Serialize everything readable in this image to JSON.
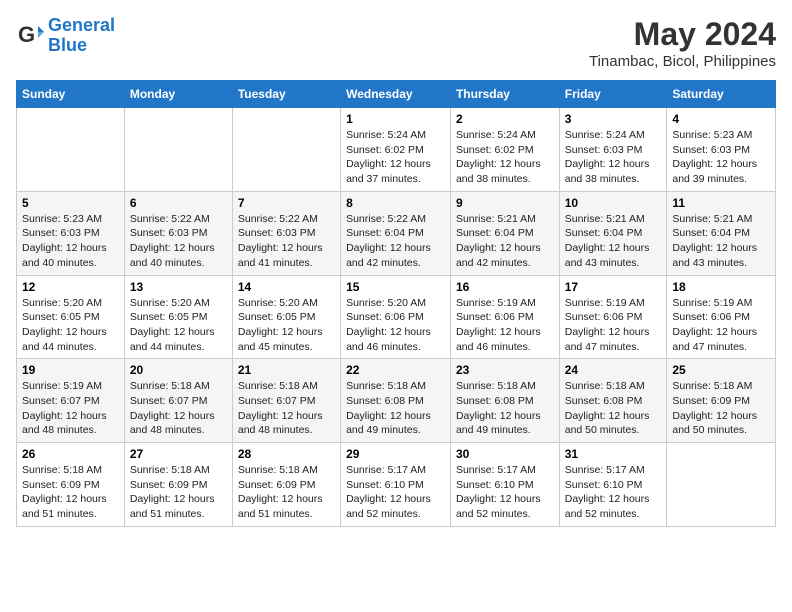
{
  "logo": {
    "line1": "General",
    "line2": "Blue"
  },
  "title": "May 2024",
  "location": "Tinambac, Bicol, Philippines",
  "weekdays": [
    "Sunday",
    "Monday",
    "Tuesday",
    "Wednesday",
    "Thursday",
    "Friday",
    "Saturday"
  ],
  "weeks": [
    [
      {
        "day": "",
        "info": ""
      },
      {
        "day": "",
        "info": ""
      },
      {
        "day": "",
        "info": ""
      },
      {
        "day": "1",
        "info": "Sunrise: 5:24 AM\nSunset: 6:02 PM\nDaylight: 12 hours\nand 37 minutes."
      },
      {
        "day": "2",
        "info": "Sunrise: 5:24 AM\nSunset: 6:02 PM\nDaylight: 12 hours\nand 38 minutes."
      },
      {
        "day": "3",
        "info": "Sunrise: 5:24 AM\nSunset: 6:03 PM\nDaylight: 12 hours\nand 38 minutes."
      },
      {
        "day": "4",
        "info": "Sunrise: 5:23 AM\nSunset: 6:03 PM\nDaylight: 12 hours\nand 39 minutes."
      }
    ],
    [
      {
        "day": "5",
        "info": "Sunrise: 5:23 AM\nSunset: 6:03 PM\nDaylight: 12 hours\nand 40 minutes."
      },
      {
        "day": "6",
        "info": "Sunrise: 5:22 AM\nSunset: 6:03 PM\nDaylight: 12 hours\nand 40 minutes."
      },
      {
        "day": "7",
        "info": "Sunrise: 5:22 AM\nSunset: 6:03 PM\nDaylight: 12 hours\nand 41 minutes."
      },
      {
        "day": "8",
        "info": "Sunrise: 5:22 AM\nSunset: 6:04 PM\nDaylight: 12 hours\nand 42 minutes."
      },
      {
        "day": "9",
        "info": "Sunrise: 5:21 AM\nSunset: 6:04 PM\nDaylight: 12 hours\nand 42 minutes."
      },
      {
        "day": "10",
        "info": "Sunrise: 5:21 AM\nSunset: 6:04 PM\nDaylight: 12 hours\nand 43 minutes."
      },
      {
        "day": "11",
        "info": "Sunrise: 5:21 AM\nSunset: 6:04 PM\nDaylight: 12 hours\nand 43 minutes."
      }
    ],
    [
      {
        "day": "12",
        "info": "Sunrise: 5:20 AM\nSunset: 6:05 PM\nDaylight: 12 hours\nand 44 minutes."
      },
      {
        "day": "13",
        "info": "Sunrise: 5:20 AM\nSunset: 6:05 PM\nDaylight: 12 hours\nand 44 minutes."
      },
      {
        "day": "14",
        "info": "Sunrise: 5:20 AM\nSunset: 6:05 PM\nDaylight: 12 hours\nand 45 minutes."
      },
      {
        "day": "15",
        "info": "Sunrise: 5:20 AM\nSunset: 6:06 PM\nDaylight: 12 hours\nand 46 minutes."
      },
      {
        "day": "16",
        "info": "Sunrise: 5:19 AM\nSunset: 6:06 PM\nDaylight: 12 hours\nand 46 minutes."
      },
      {
        "day": "17",
        "info": "Sunrise: 5:19 AM\nSunset: 6:06 PM\nDaylight: 12 hours\nand 47 minutes."
      },
      {
        "day": "18",
        "info": "Sunrise: 5:19 AM\nSunset: 6:06 PM\nDaylight: 12 hours\nand 47 minutes."
      }
    ],
    [
      {
        "day": "19",
        "info": "Sunrise: 5:19 AM\nSunset: 6:07 PM\nDaylight: 12 hours\nand 48 minutes."
      },
      {
        "day": "20",
        "info": "Sunrise: 5:18 AM\nSunset: 6:07 PM\nDaylight: 12 hours\nand 48 minutes."
      },
      {
        "day": "21",
        "info": "Sunrise: 5:18 AM\nSunset: 6:07 PM\nDaylight: 12 hours\nand 48 minutes."
      },
      {
        "day": "22",
        "info": "Sunrise: 5:18 AM\nSunset: 6:08 PM\nDaylight: 12 hours\nand 49 minutes."
      },
      {
        "day": "23",
        "info": "Sunrise: 5:18 AM\nSunset: 6:08 PM\nDaylight: 12 hours\nand 49 minutes."
      },
      {
        "day": "24",
        "info": "Sunrise: 5:18 AM\nSunset: 6:08 PM\nDaylight: 12 hours\nand 50 minutes."
      },
      {
        "day": "25",
        "info": "Sunrise: 5:18 AM\nSunset: 6:09 PM\nDaylight: 12 hours\nand 50 minutes."
      }
    ],
    [
      {
        "day": "26",
        "info": "Sunrise: 5:18 AM\nSunset: 6:09 PM\nDaylight: 12 hours\nand 51 minutes."
      },
      {
        "day": "27",
        "info": "Sunrise: 5:18 AM\nSunset: 6:09 PM\nDaylight: 12 hours\nand 51 minutes."
      },
      {
        "day": "28",
        "info": "Sunrise: 5:18 AM\nSunset: 6:09 PM\nDaylight: 12 hours\nand 51 minutes."
      },
      {
        "day": "29",
        "info": "Sunrise: 5:17 AM\nSunset: 6:10 PM\nDaylight: 12 hours\nand 52 minutes."
      },
      {
        "day": "30",
        "info": "Sunrise: 5:17 AM\nSunset: 6:10 PM\nDaylight: 12 hours\nand 52 minutes."
      },
      {
        "day": "31",
        "info": "Sunrise: 5:17 AM\nSunset: 6:10 PM\nDaylight: 12 hours\nand 52 minutes."
      },
      {
        "day": "",
        "info": ""
      }
    ]
  ]
}
